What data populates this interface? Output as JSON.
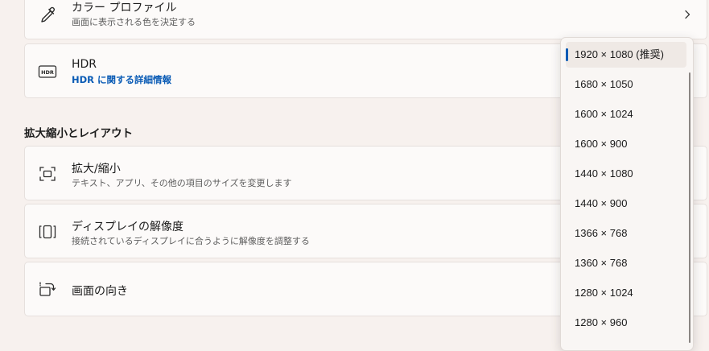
{
  "color_profile": {
    "title": "カラー プロファイル",
    "description": "画面に表示される色を決定する"
  },
  "hdr": {
    "title": "HDR",
    "link": "HDR に関する詳細情報"
  },
  "section": {
    "title": "拡大縮小とレイアウト"
  },
  "scale": {
    "title": "拡大/縮小",
    "description": "テキスト、アプリ、その他の項目のサイズを変更します"
  },
  "resolution": {
    "title": "ディスプレイの解像度",
    "description": "接続されているディスプレイに合うように解像度を調整する"
  },
  "orientation": {
    "title": "画面の向き"
  },
  "resolution_dropdown": {
    "options": [
      "1920 × 1080 (推奨)",
      "1680 × 1050",
      "1600 × 1024",
      "1600 × 900",
      "1440 × 1080",
      "1440 × 900",
      "1366 × 768",
      "1360 × 768",
      "1280 × 1024",
      "1280 × 960"
    ],
    "selected_index": 0
  },
  "colors": {
    "accent": "#0a5bb5"
  }
}
